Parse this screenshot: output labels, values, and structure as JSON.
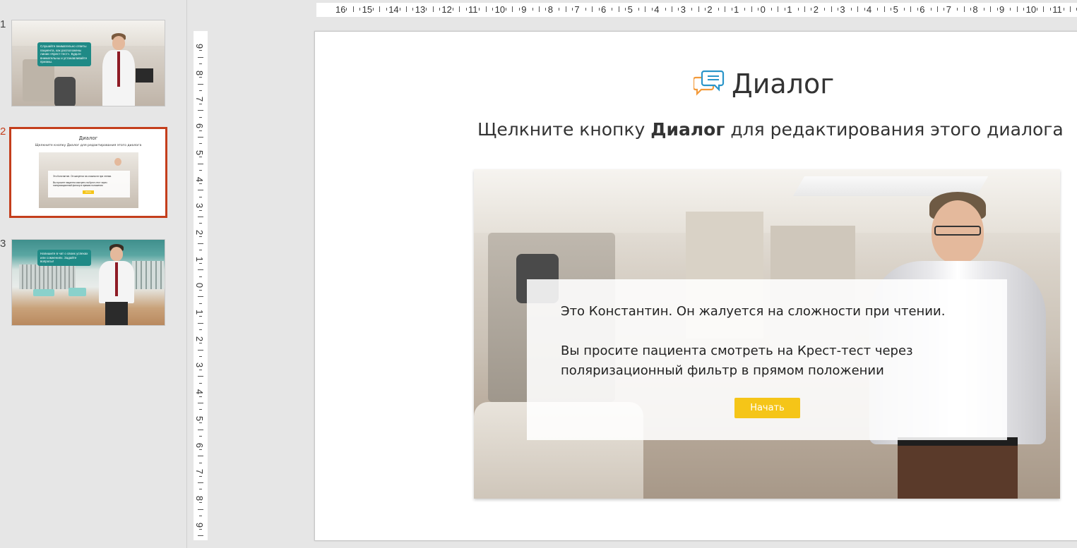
{
  "thumbnails": [
    {
      "number": "1",
      "bubble": "Слушайте внимательно ответы пациента, как расположены линии «Крест-тест». Будьте внимательны и устанавливайте призмы."
    },
    {
      "number": "2",
      "title": "Диалог",
      "subtitle": "Щелкните кнопку Диалог для редактирования этого диалога",
      "line1": "Это Константин. Он жалуется на сложности при чтении.",
      "line2": "Вы просите пациента смотреть на Крест-тест через поляризационный фильтр в прямом положении",
      "button": "Начать"
    },
    {
      "number": "3",
      "bubble": "Напишите в чат о своих успехах или сомнениях. Задайте вопросы!"
    }
  ],
  "ruler": {
    "horizontal": [
      "16",
      "15",
      "14",
      "13",
      "12",
      "11",
      "10",
      "9",
      "8",
      "7",
      "6",
      "5",
      "4",
      "3",
      "2",
      "1",
      "0",
      "1",
      "2",
      "3",
      "4",
      "5",
      "6",
      "7",
      "8",
      "9",
      "10",
      "11"
    ],
    "vertical": [
      "9",
      "8",
      "7",
      "6",
      "5",
      "4",
      "3",
      "2",
      "1",
      "0",
      "1",
      "2",
      "3",
      "4",
      "5",
      "6",
      "7",
      "8",
      "9"
    ]
  },
  "slide": {
    "title": "Диалог",
    "subtitle_pre": "Щелкните кнопку ",
    "subtitle_bold": "Диалог",
    "subtitle_post": " для редактирования этого диалога",
    "dialog": {
      "line1": "Это Константин. Он жалуется на сложности при чтении.",
      "line2a": "Вы просите пациента смотреть на Крест-тест через",
      "line2b": "поляризационный фильтр в прямом положении",
      "button": "Начать"
    }
  },
  "colors": {
    "accent": "#c43e1c",
    "button": "#f5c518",
    "bubble": "#1f8a86"
  },
  "icons": {
    "dialog": "chat-bubbles-icon"
  }
}
